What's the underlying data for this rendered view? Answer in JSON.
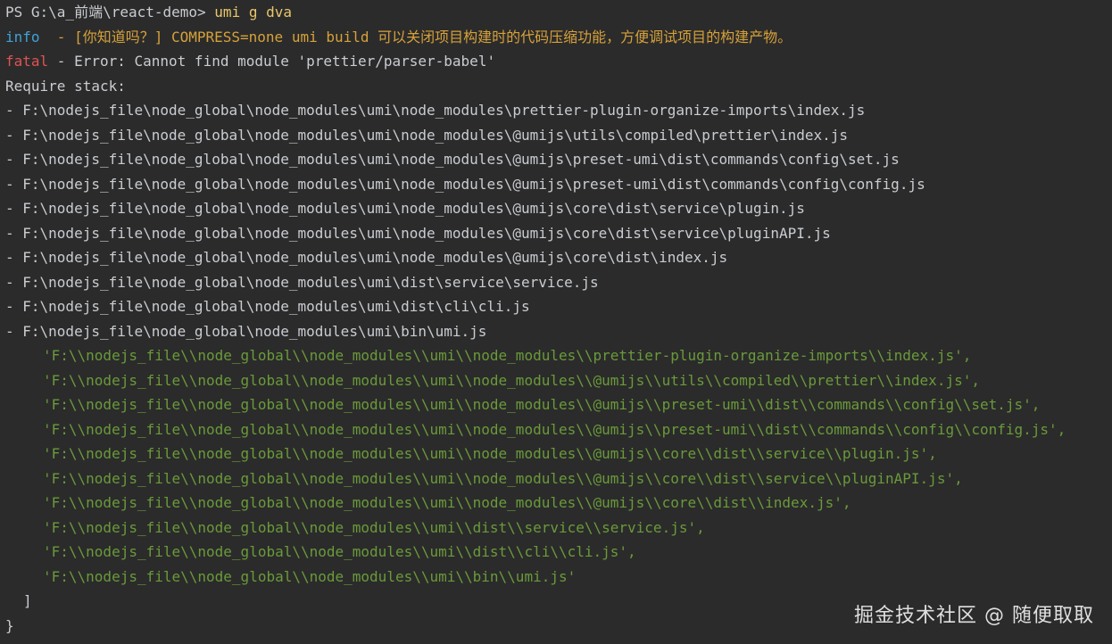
{
  "terminal": {
    "prompt": "PS G:\\a_前端\\react-demo> ",
    "command": "umi g dva",
    "info_tag": "info",
    "info_sep": "  - ",
    "info_text": "[你知道吗？] COMPRESS=none umi build 可以关闭项目构建时的代码压缩功能，方便调试项目的构建产物。",
    "fatal_tag": "fatal",
    "fatal_text": " - Error: Cannot find module 'prettier/parser-babel'",
    "require_stack": "Require stack:",
    "stack_lines": [
      "- F:\\nodejs_file\\node_global\\node_modules\\umi\\node_modules\\prettier-plugin-organize-imports\\index.js",
      "- F:\\nodejs_file\\node_global\\node_modules\\umi\\node_modules\\@umijs\\utils\\compiled\\prettier\\index.js",
      "- F:\\nodejs_file\\node_global\\node_modules\\umi\\node_modules\\@umijs\\preset-umi\\dist\\commands\\config\\set.js",
      "- F:\\nodejs_file\\node_global\\node_modules\\umi\\node_modules\\@umijs\\preset-umi\\dist\\commands\\config\\config.js",
      "- F:\\nodejs_file\\node_global\\node_modules\\umi\\node_modules\\@umijs\\core\\dist\\service\\plugin.js",
      "- F:\\nodejs_file\\node_global\\node_modules\\umi\\node_modules\\@umijs\\core\\dist\\service\\pluginAPI.js",
      "- F:\\nodejs_file\\node_global\\node_modules\\umi\\node_modules\\@umijs\\core\\dist\\index.js",
      "- F:\\nodejs_file\\node_global\\node_modules\\umi\\dist\\service\\service.js",
      "- F:\\nodejs_file\\node_global\\node_modules\\umi\\dist\\cli\\cli.js",
      "- F:\\nodejs_file\\node_global\\node_modules\\umi\\bin\\umi.js"
    ],
    "string_lines": [
      "'F:\\\\nodejs_file\\\\node_global\\\\node_modules\\\\umi\\\\node_modules\\\\prettier-plugin-organize-imports\\\\index.js',",
      "'F:\\\\nodejs_file\\\\node_global\\\\node_modules\\\\umi\\\\node_modules\\\\@umijs\\\\utils\\\\compiled\\\\prettier\\\\index.js',",
      "'F:\\\\nodejs_file\\\\node_global\\\\node_modules\\\\umi\\\\node_modules\\\\@umijs\\\\preset-umi\\\\dist\\\\commands\\\\config\\\\set.js',",
      "'F:\\\\nodejs_file\\\\node_global\\\\node_modules\\\\umi\\\\node_modules\\\\@umijs\\\\preset-umi\\\\dist\\\\commands\\\\config\\\\config.js',",
      "'F:\\\\nodejs_file\\\\node_global\\\\node_modules\\\\umi\\\\node_modules\\\\@umijs\\\\core\\\\dist\\\\service\\\\plugin.js',",
      "'F:\\\\nodejs_file\\\\node_global\\\\node_modules\\\\umi\\\\node_modules\\\\@umijs\\\\core\\\\dist\\\\service\\\\pluginAPI.js',",
      "'F:\\\\nodejs_file\\\\node_global\\\\node_modules\\\\umi\\\\node_modules\\\\@umijs\\\\core\\\\dist\\\\index.js',",
      "'F:\\\\nodejs_file\\\\node_global\\\\node_modules\\\\umi\\\\dist\\\\service\\\\service.js',",
      "'F:\\\\nodejs_file\\\\node_global\\\\node_modules\\\\umi\\\\dist\\\\cli\\\\cli.js',",
      "'F:\\\\nodejs_file\\\\node_global\\\\node_modules\\\\umi\\\\bin\\\\umi.js'"
    ],
    "close_bracket": "]",
    "close_brace": "}"
  },
  "watermark": "掘金技术社区 @ 随便取取",
  "colors": {
    "background": "#2b2b2b",
    "command": "#e8c66a",
    "info": "#3fa3d8",
    "warning": "#d6a13a",
    "fatal": "#e05252",
    "string": "#6a9a3a"
  }
}
